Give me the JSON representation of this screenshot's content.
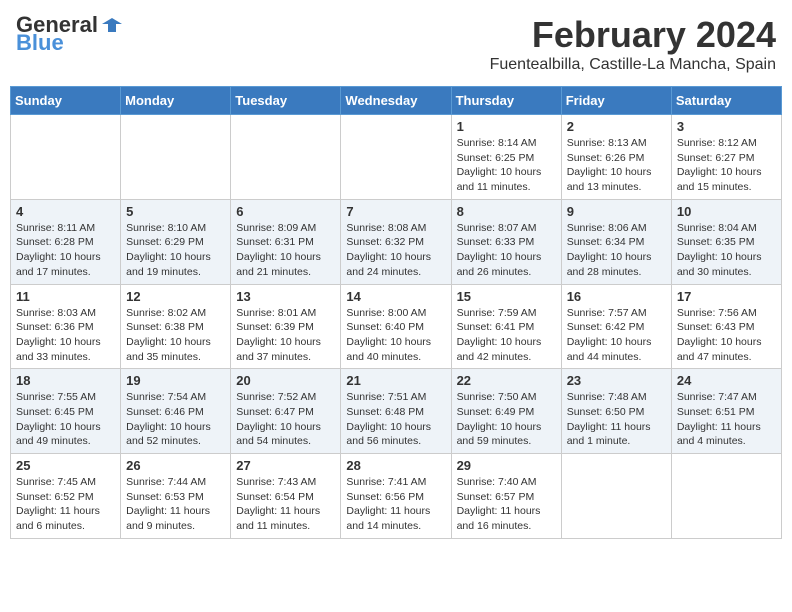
{
  "header": {
    "logo_general": "General",
    "logo_blue": "Blue",
    "month_title": "February 2024",
    "location": "Fuentealbilla, Castille-La Mancha, Spain"
  },
  "days_of_week": [
    "Sunday",
    "Monday",
    "Tuesday",
    "Wednesday",
    "Thursday",
    "Friday",
    "Saturday"
  ],
  "weeks": [
    [
      {
        "day": "",
        "info": ""
      },
      {
        "day": "",
        "info": ""
      },
      {
        "day": "",
        "info": ""
      },
      {
        "day": "",
        "info": ""
      },
      {
        "day": "1",
        "info": "Sunrise: 8:14 AM\nSunset: 6:25 PM\nDaylight: 10 hours\nand 11 minutes."
      },
      {
        "day": "2",
        "info": "Sunrise: 8:13 AM\nSunset: 6:26 PM\nDaylight: 10 hours\nand 13 minutes."
      },
      {
        "day": "3",
        "info": "Sunrise: 8:12 AM\nSunset: 6:27 PM\nDaylight: 10 hours\nand 15 minutes."
      }
    ],
    [
      {
        "day": "4",
        "info": "Sunrise: 8:11 AM\nSunset: 6:28 PM\nDaylight: 10 hours\nand 17 minutes."
      },
      {
        "day": "5",
        "info": "Sunrise: 8:10 AM\nSunset: 6:29 PM\nDaylight: 10 hours\nand 19 minutes."
      },
      {
        "day": "6",
        "info": "Sunrise: 8:09 AM\nSunset: 6:31 PM\nDaylight: 10 hours\nand 21 minutes."
      },
      {
        "day": "7",
        "info": "Sunrise: 8:08 AM\nSunset: 6:32 PM\nDaylight: 10 hours\nand 24 minutes."
      },
      {
        "day": "8",
        "info": "Sunrise: 8:07 AM\nSunset: 6:33 PM\nDaylight: 10 hours\nand 26 minutes."
      },
      {
        "day": "9",
        "info": "Sunrise: 8:06 AM\nSunset: 6:34 PM\nDaylight: 10 hours\nand 28 minutes."
      },
      {
        "day": "10",
        "info": "Sunrise: 8:04 AM\nSunset: 6:35 PM\nDaylight: 10 hours\nand 30 minutes."
      }
    ],
    [
      {
        "day": "11",
        "info": "Sunrise: 8:03 AM\nSunset: 6:36 PM\nDaylight: 10 hours\nand 33 minutes."
      },
      {
        "day": "12",
        "info": "Sunrise: 8:02 AM\nSunset: 6:38 PM\nDaylight: 10 hours\nand 35 minutes."
      },
      {
        "day": "13",
        "info": "Sunrise: 8:01 AM\nSunset: 6:39 PM\nDaylight: 10 hours\nand 37 minutes."
      },
      {
        "day": "14",
        "info": "Sunrise: 8:00 AM\nSunset: 6:40 PM\nDaylight: 10 hours\nand 40 minutes."
      },
      {
        "day": "15",
        "info": "Sunrise: 7:59 AM\nSunset: 6:41 PM\nDaylight: 10 hours\nand 42 minutes."
      },
      {
        "day": "16",
        "info": "Sunrise: 7:57 AM\nSunset: 6:42 PM\nDaylight: 10 hours\nand 44 minutes."
      },
      {
        "day": "17",
        "info": "Sunrise: 7:56 AM\nSunset: 6:43 PM\nDaylight: 10 hours\nand 47 minutes."
      }
    ],
    [
      {
        "day": "18",
        "info": "Sunrise: 7:55 AM\nSunset: 6:45 PM\nDaylight: 10 hours\nand 49 minutes."
      },
      {
        "day": "19",
        "info": "Sunrise: 7:54 AM\nSunset: 6:46 PM\nDaylight: 10 hours\nand 52 minutes."
      },
      {
        "day": "20",
        "info": "Sunrise: 7:52 AM\nSunset: 6:47 PM\nDaylight: 10 hours\nand 54 minutes."
      },
      {
        "day": "21",
        "info": "Sunrise: 7:51 AM\nSunset: 6:48 PM\nDaylight: 10 hours\nand 56 minutes."
      },
      {
        "day": "22",
        "info": "Sunrise: 7:50 AM\nSunset: 6:49 PM\nDaylight: 10 hours\nand 59 minutes."
      },
      {
        "day": "23",
        "info": "Sunrise: 7:48 AM\nSunset: 6:50 PM\nDaylight: 11 hours\nand 1 minute."
      },
      {
        "day": "24",
        "info": "Sunrise: 7:47 AM\nSunset: 6:51 PM\nDaylight: 11 hours\nand 4 minutes."
      }
    ],
    [
      {
        "day": "25",
        "info": "Sunrise: 7:45 AM\nSunset: 6:52 PM\nDaylight: 11 hours\nand 6 minutes."
      },
      {
        "day": "26",
        "info": "Sunrise: 7:44 AM\nSunset: 6:53 PM\nDaylight: 11 hours\nand 9 minutes."
      },
      {
        "day": "27",
        "info": "Sunrise: 7:43 AM\nSunset: 6:54 PM\nDaylight: 11 hours\nand 11 minutes."
      },
      {
        "day": "28",
        "info": "Sunrise: 7:41 AM\nSunset: 6:56 PM\nDaylight: 11 hours\nand 14 minutes."
      },
      {
        "day": "29",
        "info": "Sunrise: 7:40 AM\nSunset: 6:57 PM\nDaylight: 11 hours\nand 16 minutes."
      },
      {
        "day": "",
        "info": ""
      },
      {
        "day": "",
        "info": ""
      }
    ]
  ]
}
